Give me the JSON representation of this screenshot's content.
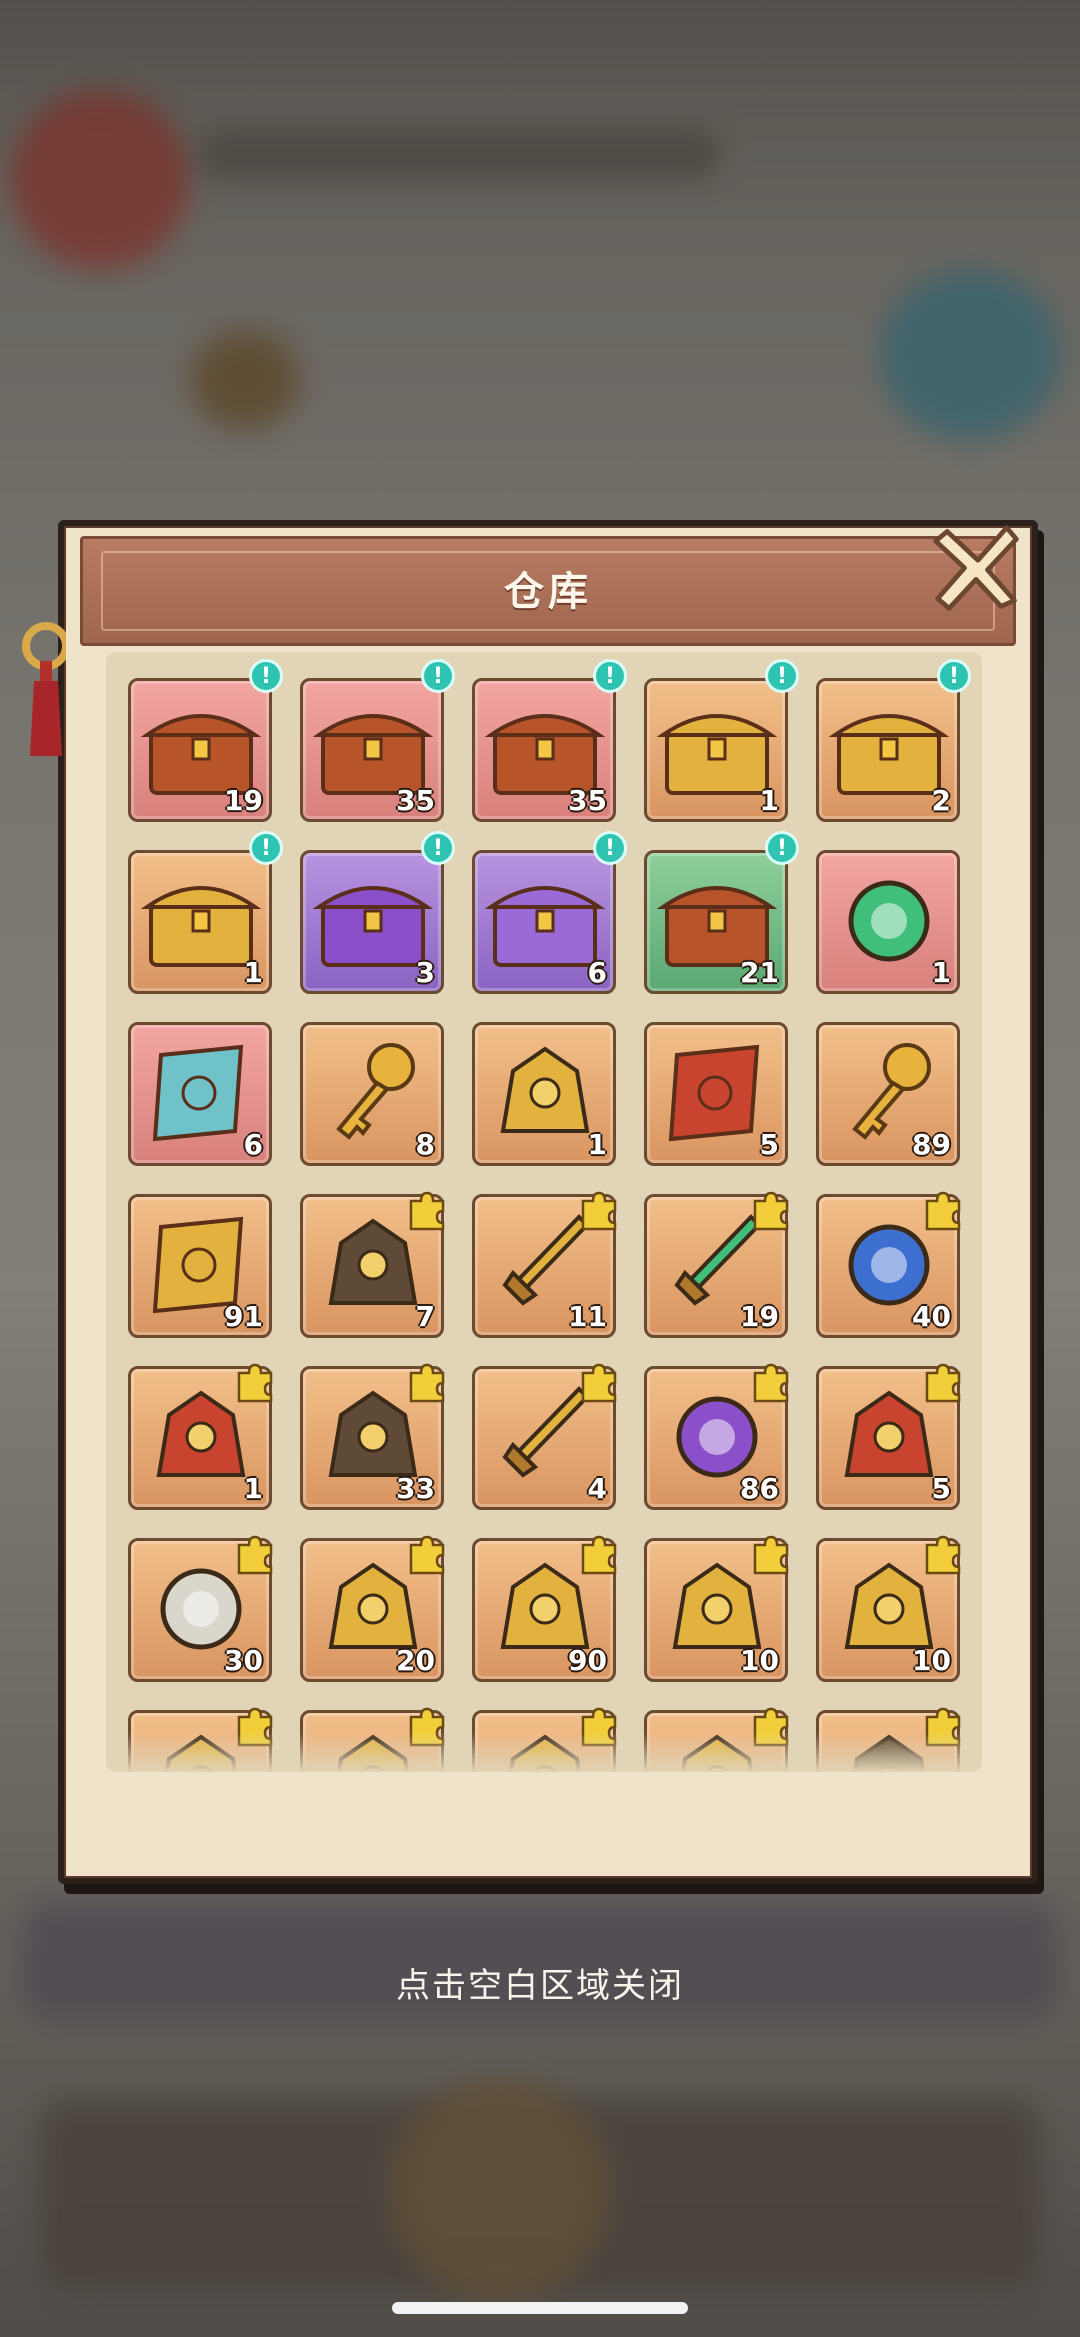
{
  "panel": {
    "title": "仓库",
    "close_icon": "close-x-icon"
  },
  "hint": "点击空白区域关闭",
  "colors": {
    "orange": "#f2bf8a",
    "pink": "#f3a6a1",
    "purple": "#b894e0",
    "green": "#8fcf9c",
    "alert": "#2fc4b2"
  },
  "items": [
    {
      "icon": "treasure-chest-icon",
      "rarity": "pink",
      "count": "19",
      "alert": "!"
    },
    {
      "icon": "treasure-chest-icon",
      "rarity": "pink",
      "count": "35",
      "alert": "!"
    },
    {
      "icon": "treasure-chest-icon",
      "rarity": "pink",
      "count": "35",
      "alert": "!"
    },
    {
      "icon": "golden-spirit-chest-icon",
      "rarity": "orange",
      "count": "1",
      "alert": "!"
    },
    {
      "icon": "mystery-chest-icon",
      "rarity": "orange",
      "count": "2",
      "alert": "!"
    },
    {
      "icon": "egg-chest-icon",
      "rarity": "orange",
      "count": "1",
      "alert": "!"
    },
    {
      "icon": "purple-puzzle-chest-icon",
      "rarity": "purple",
      "count": "3",
      "alert": "!"
    },
    {
      "icon": "gem-chest-icon",
      "rarity": "purple",
      "count": "6",
      "alert": "!"
    },
    {
      "icon": "treasure-chest-icon",
      "rarity": "green",
      "count": "21",
      "alert": "!"
    },
    {
      "icon": "green-vortex-orb-icon",
      "rarity": "pink",
      "count": "1"
    },
    {
      "icon": "treasure-map-icon",
      "rarity": "pink",
      "count": "6"
    },
    {
      "icon": "golden-key-icon",
      "rarity": "orange",
      "count": "8"
    },
    {
      "icon": "golden-plaque-spoon-icon",
      "rarity": "orange",
      "count": "1"
    },
    {
      "icon": "red-scroll-icon",
      "rarity": "orange",
      "count": "5"
    },
    {
      "icon": "golden-key-icon",
      "rarity": "orange",
      "count": "89"
    },
    {
      "icon": "golden-scroll-icon",
      "rarity": "orange",
      "count": "91"
    },
    {
      "icon": "pagoda-lantern-fragment-icon",
      "rarity": "orange",
      "count": "7",
      "puzzle": true
    },
    {
      "icon": "golden-axe-fragment-icon",
      "rarity": "orange",
      "count": "11",
      "puzzle": true
    },
    {
      "icon": "jade-blade-fragment-icon",
      "rarity": "orange",
      "count": "19",
      "puzzle": true
    },
    {
      "icon": "blue-orb-mirror-fragment-icon",
      "rarity": "orange",
      "count": "40",
      "puzzle": true
    },
    {
      "icon": "fire-wheel-fragment-icon",
      "rarity": "orange",
      "count": "1",
      "puzzle": true
    },
    {
      "icon": "bronze-cauldron-fragment-icon",
      "rarity": "orange",
      "count": "33",
      "puzzle": true
    },
    {
      "icon": "golden-sword-fragment-icon",
      "rarity": "orange",
      "count": "4",
      "puzzle": true
    },
    {
      "icon": "purple-gem-ring-fragment-icon",
      "rarity": "orange",
      "count": "86",
      "puzzle": true
    },
    {
      "icon": "flame-tripod-fragment-icon",
      "rarity": "orange",
      "count": "5",
      "puzzle": true
    },
    {
      "icon": "silver-mirror-fragment-icon",
      "rarity": "orange",
      "count": "30",
      "puzzle": true
    },
    {
      "icon": "jeweled-pendant-fragment-icon",
      "rarity": "orange",
      "count": "20",
      "puzzle": true
    },
    {
      "icon": "balance-scale-fragment-icon",
      "rarity": "orange",
      "count": "90",
      "puzzle": true
    },
    {
      "icon": "dragon-seal-fragment-icon",
      "rarity": "orange",
      "count": "10",
      "puzzle": true
    },
    {
      "icon": "dragon-seal-fragment-icon",
      "rarity": "orange",
      "count": "10",
      "puzzle": true
    },
    {
      "icon": "dragon-seal-fragment-icon",
      "rarity": "orange",
      "count": "",
      "puzzle": true
    },
    {
      "icon": "dragon-seal-fragment-icon",
      "rarity": "orange",
      "count": "",
      "puzzle": true
    },
    {
      "icon": "dragon-seal-fragment-icon",
      "rarity": "orange",
      "count": "",
      "puzzle": true
    },
    {
      "icon": "dragon-seal-fragment-icon",
      "rarity": "orange",
      "count": "",
      "puzzle": true
    },
    {
      "icon": "dark-portrait-fragment-icon",
      "rarity": "orange",
      "count": "",
      "puzzle": true
    }
  ]
}
